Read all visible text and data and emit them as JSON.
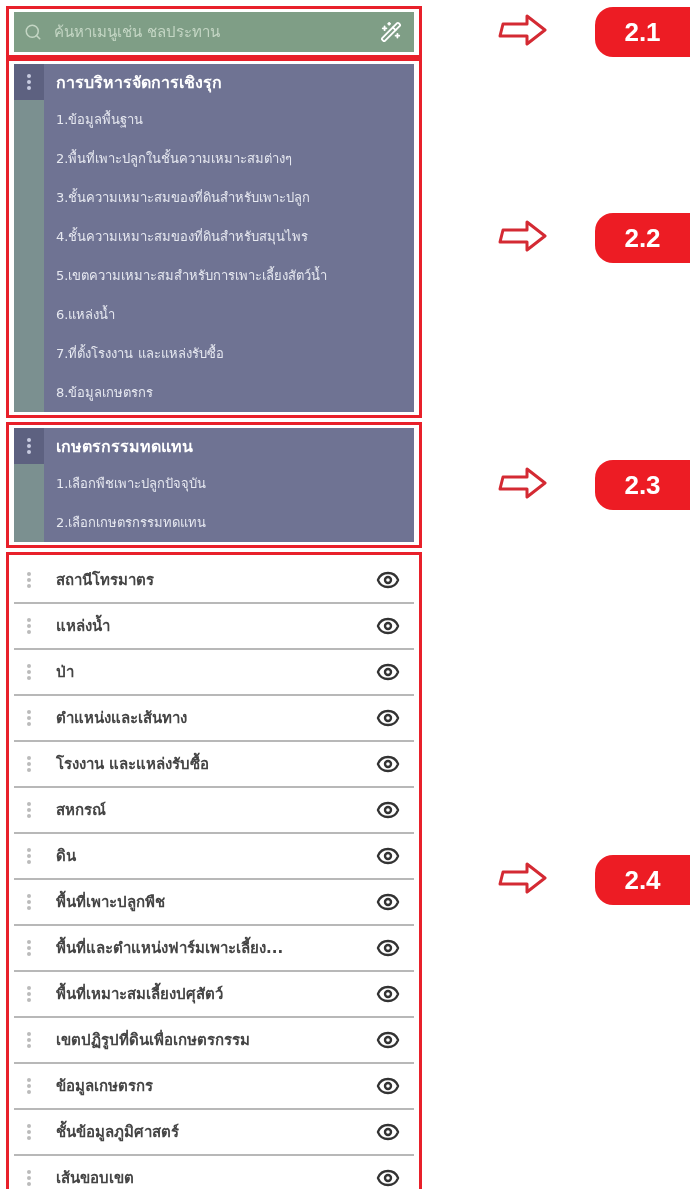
{
  "sections": [
    {
      "kind": "search",
      "annotation": "2.1",
      "placeholder": "ค้นหาเมนูเช่น ชลประทาน"
    },
    {
      "kind": "group",
      "annotation": "2.2",
      "title": "การบริหารจัดการเชิงรุก",
      "items": [
        "1.ข้อมูลพื้นฐาน",
        "2.พื้นที่เพาะปลูกในชั้นความเหมาะสมต่างๆ",
        "3.ชั้นความเหมาะสมของที่ดินสำหรับเพาะปลูก",
        "4.ชั้นความเหมาะสมของที่ดินสำหรับสมุนไพร",
        "5.เขตความเหมาะสมสำหรับการเพาะเลี้ยงสัตว์น้ำ",
        "6.แหล่งน้ำ",
        "7.ที่ตั้งโรงงาน และแหล่งรับซื้อ",
        "8.ข้อมูลเกษตรกร"
      ]
    },
    {
      "kind": "group",
      "annotation": "2.3",
      "title": "เกษตรกรรมทดแทน",
      "items": [
        "1.เลือกพืชเพาะปลูกปัจจุบัน",
        "2.เลือกเกษตรกรรมทดแทน"
      ]
    },
    {
      "kind": "layers",
      "annotation": "2.4",
      "items": [
        "สถานีโทรมาตร",
        "แหล่งน้ำ",
        "ป่า",
        "ตำแหน่งและเส้นทาง",
        "โรงงาน และแหล่งรับซื้อ",
        "สหกรณ์",
        "ดิน",
        "พื้นที่เพาะปลูกพืช",
        "พื้นที่และตำแหน่งฟาร์มเพาะเลี้ยง...",
        "พื้นที่เหมาะสมเลี้ยงปศุสัตว์",
        "เขตปฏิรูปที่ดินเพื่อเกษตรกรรม",
        "ข้อมูลเกษตรกร",
        "ชั้นข้อมูลภูมิศาสตร์",
        "เส้นขอบเขต"
      ]
    }
  ]
}
